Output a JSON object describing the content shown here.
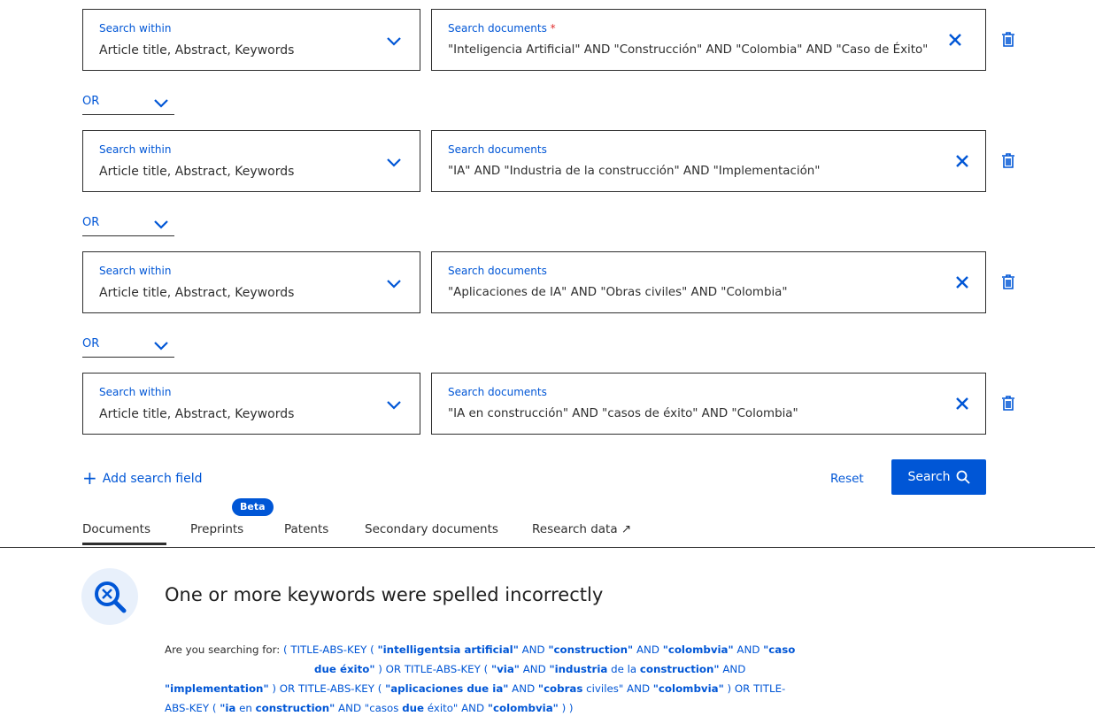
{
  "rows": [
    {
      "within_label": "Search within",
      "within_value": "Article title, Abstract, Keywords",
      "docs_label": "Search documents",
      "docs_required": "*",
      "docs_value": "\"Inteligencia Artificial\" AND \"Construcción\" AND \"Colombia\" AND \"Caso de Éxito\""
    },
    {
      "within_label": "Search within",
      "within_value": "Article title, Abstract, Keywords",
      "docs_label": "Search documents",
      "docs_value": "\"IA\" AND \"Industria de la construcción\" AND \"Implementación\""
    },
    {
      "within_label": "Search within",
      "within_value": "Article title, Abstract, Keywords",
      "docs_label": "Search documents",
      "docs_value": "\"Aplicaciones de IA\" AND \"Obras civiles\" AND \"Colombia\""
    },
    {
      "within_label": "Search within",
      "within_value": "Article title, Abstract, Keywords",
      "docs_label": "Search documents",
      "docs_value": "\"IA en construcción\" AND \"casos de éxito\" AND \"Colombia\""
    }
  ],
  "operators": [
    "OR",
    "OR",
    "OR"
  ],
  "actions": {
    "add_field": "Add search field",
    "reset": "Reset",
    "search": "Search"
  },
  "tabs": [
    {
      "label": "Documents",
      "active": true
    },
    {
      "label": "Preprints",
      "badge": "Beta"
    },
    {
      "label": "Patents"
    },
    {
      "label": "Secondary documents"
    },
    {
      "label": "Research data ↗"
    }
  ],
  "alert": {
    "title": "One or more keywords were spelled incorrectly",
    "lead": "Are you searching for:",
    "suggestion_parts": [
      "( TITLE-ABS-KEY ( ",
      "\"intelligentsia artificial\"",
      " AND ",
      "\"construction\"",
      " AND ",
      "\"colombvia\"",
      " AND ",
      "\"caso",
      "due éxito\"",
      " ) OR TITLE-ABS-KEY ( ",
      "\"via\"",
      " AND ",
      "\"industria",
      " de la ",
      "construction\"",
      " AND",
      "\"implementation\"",
      " ) OR TITLE-ABS-KEY ( ",
      "\"aplicaciones due ia\"",
      " AND ",
      "\"cobras",
      " civiles\" AND ",
      "\"colombvia\"",
      " ) OR TITLE-",
      "ABS-KEY ( ",
      "\"ia",
      " en ",
      "construction\"",
      " AND \"casos ",
      "due",
      " éxito\" AND ",
      "\"colombvia\"",
      " ) )"
    ]
  },
  "colors": {
    "accent": "#0056d6",
    "text": "#2e2e2e",
    "required": "#e02e2e"
  }
}
